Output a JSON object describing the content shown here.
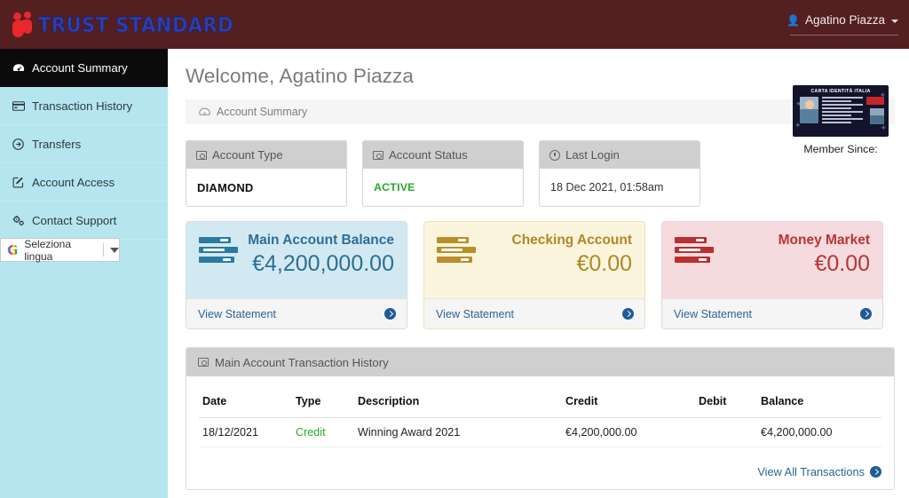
{
  "brand": {
    "name": "TRUST STANDARD",
    "logo_icon": "two-people-heart-icon"
  },
  "topbar": {
    "user_name": "Agatino Piazza",
    "user_icon": "user-icon",
    "caret_icon": "caret-down-icon"
  },
  "sidebar": {
    "items": [
      {
        "label": "Account Summary",
        "icon": "dashboard-icon",
        "active": true
      },
      {
        "label": "Transaction History",
        "icon": "credit-card-icon",
        "active": false
      },
      {
        "label": "Transfers",
        "icon": "arrow-circle-right-icon",
        "active": false
      },
      {
        "label": "Account Access",
        "icon": "pen-square-icon",
        "active": false
      },
      {
        "label": "Contact Support",
        "icon": "cogs-icon",
        "active": false
      }
    ],
    "translate_widget": {
      "label": "Seleziona lingua",
      "logo": "google-g-icon",
      "caret_icon": "caret-down-icon"
    }
  },
  "main": {
    "welcome_title": "Welcome, Agatino Piazza",
    "breadcrumb": {
      "label": "Account Summary",
      "icon": "dashboard-icon"
    },
    "info_cards": [
      {
        "title": "Account Type",
        "icon": "id-badge-icon",
        "value": "DIAMOND",
        "style": "bold"
      },
      {
        "title": "Account Status",
        "icon": "id-badge-icon",
        "value": "ACTIVE",
        "style": "green"
      },
      {
        "title": "Last Login",
        "icon": "clock-icon",
        "value": "18 Dec 2021, 01:58am",
        "style": "plain"
      }
    ],
    "id_card": {
      "title": "CARTA IDENTITÀ ITALIA",
      "caption": "Member Since:",
      "image_alt": "italian-identity-card"
    },
    "balance_cards": [
      {
        "title": "Main Account Balance",
        "amount": "€4,200,000.00",
        "link_label": "View Statement",
        "icon": "server-bars-icon",
        "accent": "#2b6f97",
        "bg": "#d3e9f2"
      },
      {
        "title": "Checking Account",
        "amount": "€0.00",
        "link_label": "View Statement",
        "icon": "server-bars-icon",
        "accent": "#b08728",
        "bg": "#fcf5dd"
      },
      {
        "title": "Money Market",
        "amount": "€0.00",
        "link_label": "View Statement",
        "icon": "server-bars-icon",
        "accent": "#b93437",
        "bg": "#f5dbdd"
      }
    ],
    "transactions_panel": {
      "title": "Main Account Transaction History",
      "icon": "id-badge-icon",
      "columns": [
        "Date",
        "Type",
        "Description",
        "Credit",
        "Debit",
        "Balance"
      ],
      "rows": [
        {
          "date": "18/12/2021",
          "type": "Credit",
          "description": "Winning Award 2021",
          "credit": "€4,200,000.00",
          "debit": "",
          "balance": "€4,200,000.00"
        }
      ],
      "view_all_label": "View All Transactions",
      "view_all_icon": "arrow-circle-right-icon"
    }
  }
}
